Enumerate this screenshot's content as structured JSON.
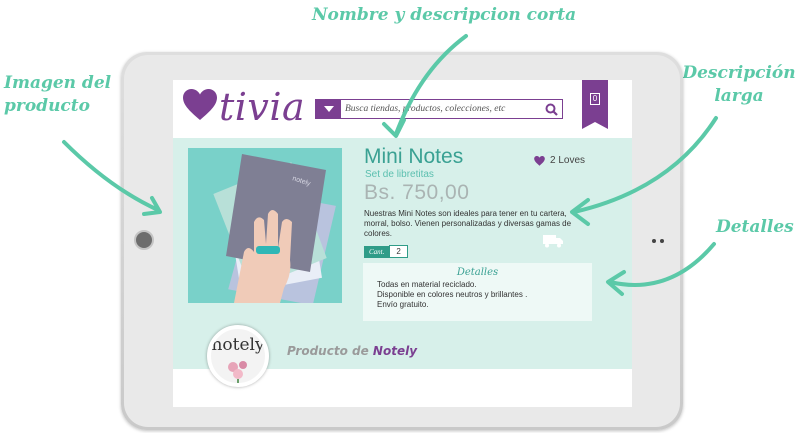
{
  "annotations": {
    "top": "Nombre y descripcion corta",
    "left": "Imagen del producto",
    "right": "Descripción larga",
    "details": "Detalles"
  },
  "app": {
    "logo": "tivia",
    "brand_color": "#7b3f91",
    "accent_color": "#3aa193",
    "content_bg": "#d7f0ea"
  },
  "search": {
    "placeholder": "Busca tiendas, productos, colecciones, etc"
  },
  "cart": {
    "count": "0"
  },
  "product": {
    "name": "Mini Notes",
    "short_description": "Set de libretitas",
    "price": "Bs. 750,00",
    "loves": "2 Loves",
    "long_description": "Nuestras Mini Notes son ideales para tener en tu cartera, morral, bolso. Vienen personalizadas y diversas gamas de colores.",
    "quantity_label": "Cant.",
    "quantity_value": "2",
    "notebook_brand": "notely"
  },
  "details": {
    "title": "Detalles",
    "items": [
      "Todas en material reciclado.",
      "Disponible en colores neutros y brillantes .",
      "Envío gratuito."
    ]
  },
  "brand": {
    "logo_text": "notely",
    "prefix": "Producto de",
    "name": "Notely"
  }
}
